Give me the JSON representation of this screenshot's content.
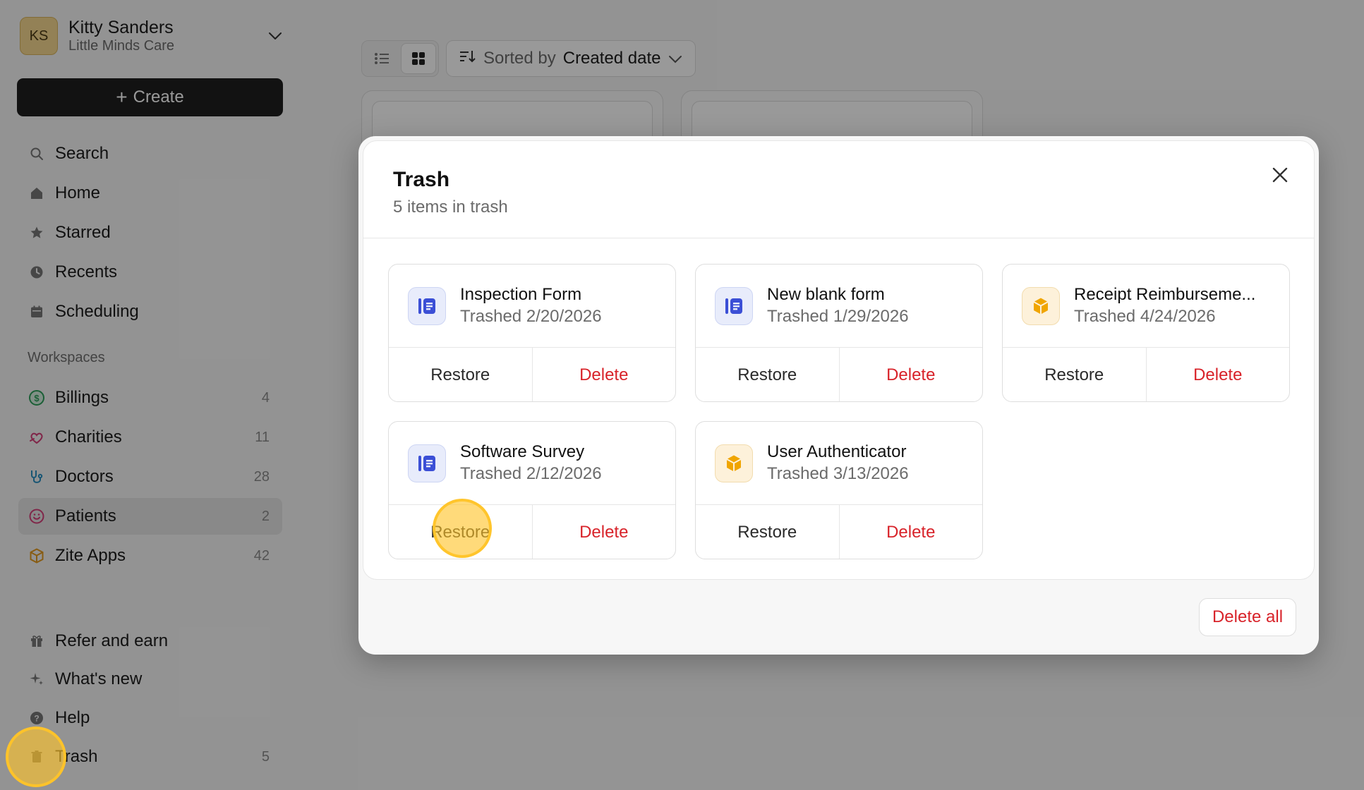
{
  "account": {
    "initials": "KS",
    "name": "Kitty Sanders",
    "org": "Little Minds Care"
  },
  "create_label": "Create",
  "nav": {
    "search": "Search",
    "home": "Home",
    "starred": "Starred",
    "recents": "Recents",
    "scheduling": "Scheduling"
  },
  "workspaces_label": "Workspaces",
  "workspaces": [
    {
      "label": "Billings",
      "count": "4",
      "color": "#2e9e5b"
    },
    {
      "label": "Charities",
      "count": "11",
      "color": "#d6407a"
    },
    {
      "label": "Doctors",
      "count": "28",
      "color": "#2a8fc1"
    },
    {
      "label": "Patients",
      "count": "2",
      "color": "#d6407a"
    },
    {
      "label": "Zite Apps",
      "count": "42",
      "color": "#e39a21"
    }
  ],
  "bottom_nav": {
    "refer": "Refer and earn",
    "whats_new": "What's new",
    "help": "Help",
    "trash": "Trash",
    "trash_count": "5"
  },
  "toolbar": {
    "sort_prefix": "Sorted by",
    "sort_value": "Created date"
  },
  "modal": {
    "title": "Trash",
    "subtitle": "5 items in trash",
    "restore_label": "Restore",
    "delete_label": "Delete",
    "delete_all_label": "Delete all",
    "items": [
      {
        "name": "Inspection Form",
        "trashed": "Trashed 2/20/2026",
        "icon": "form-icon"
      },
      {
        "name": "New blank form",
        "trashed": "Trashed 1/29/2026",
        "icon": "form-icon"
      },
      {
        "name": "Receipt Reimburseme...",
        "trashed": "Trashed 4/24/2026",
        "icon": "app-cube-icon"
      },
      {
        "name": "Software Survey",
        "trashed": "Trashed 2/12/2026",
        "icon": "form-icon"
      },
      {
        "name": "User Authenticator",
        "trashed": "Trashed 3/13/2026",
        "icon": "app-cube-icon"
      }
    ]
  },
  "colors": {
    "accent_dark": "#1f1f1f",
    "danger": "#d8232a",
    "form_icon": "#3b4fd6",
    "app_icon": "#f0a500",
    "click_highlight": "#ffc428"
  }
}
